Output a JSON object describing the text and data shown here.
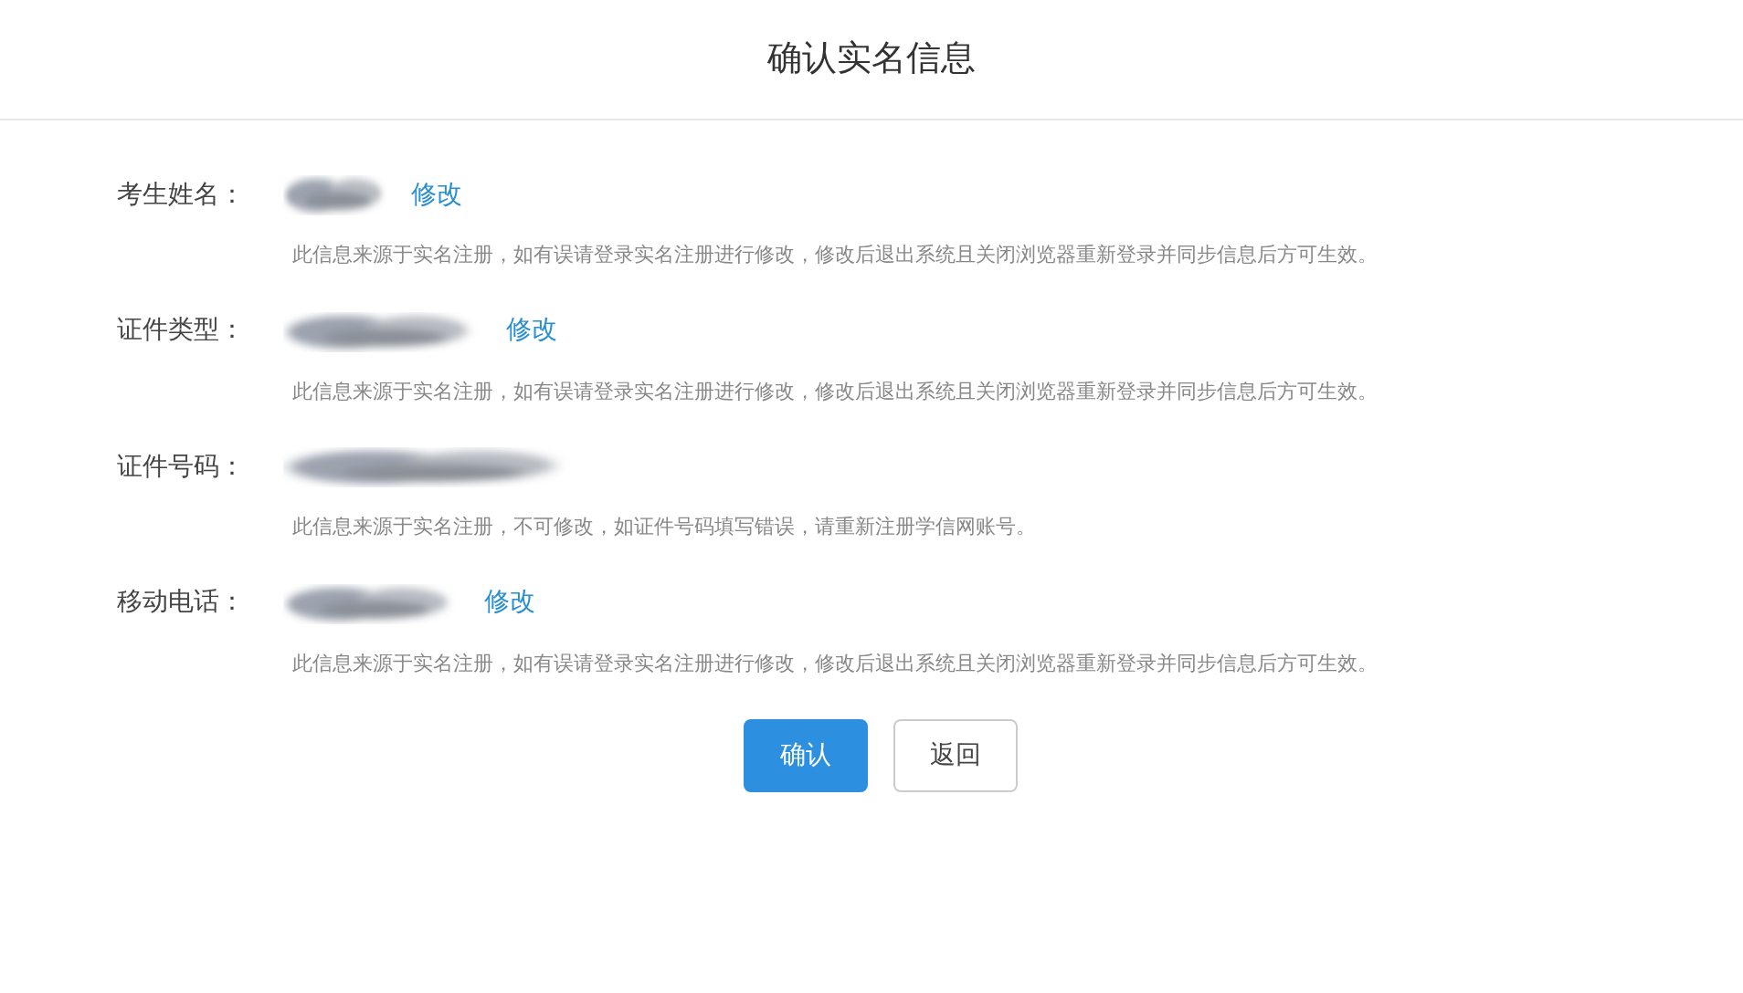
{
  "dialog": {
    "title": "确认实名信息"
  },
  "fields": [
    {
      "label": "考生姓名：",
      "value": {
        "kind": "redacted"
      },
      "edit_link": "修改",
      "hint": "此信息来源于实名注册，如有误请登录实名注册进行修改，修改后退出系统且关闭浏览器重新登录并同步信息后方可生效。"
    },
    {
      "label": "证件类型：",
      "value": {
        "kind": "redacted"
      },
      "edit_link": "修改",
      "hint": "此信息来源于实名注册，如有误请登录实名注册进行修改，修改后退出系统且关闭浏览器重新登录并同步信息后方可生效。"
    },
    {
      "label": "证件号码：",
      "value": {
        "kind": "redacted"
      },
      "hint": "此信息来源于实名注册，不可修改，如证件号码填写错误，请重新注册学信网账号。"
    },
    {
      "label": "移动电话：",
      "value": {
        "kind": "redacted"
      },
      "edit_link": "修改",
      "hint": "此信息来源于实名注册，如有误请登录实名注册进行修改，修改后退出系统且关闭浏览器重新登录并同步信息后方可生效。"
    }
  ],
  "buttons": [
    {
      "label": "确认",
      "kind": "primary"
    },
    {
      "label": "返回",
      "kind": "secondary"
    }
  ]
}
